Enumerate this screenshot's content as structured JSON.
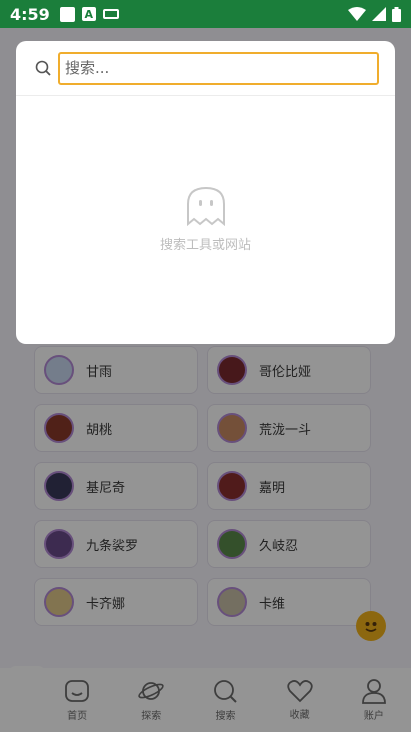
{
  "status_bar": {
    "time": "4:59"
  },
  "search": {
    "placeholder": "搜索...",
    "empty_text": "搜索工具或网站"
  },
  "cards": [
    {
      "label": "甘雨"
    },
    {
      "label": "哥伦比娅"
    },
    {
      "label": "胡桃"
    },
    {
      "label": "荒泷一斗"
    },
    {
      "label": "基尼奇"
    },
    {
      "label": "嘉明"
    },
    {
      "label": "九条裟罗"
    },
    {
      "label": "久岐忍"
    },
    {
      "label": "卡齐娜"
    },
    {
      "label": "卡维"
    }
  ],
  "nav": [
    {
      "label": "首页",
      "icon": "home-icon"
    },
    {
      "label": "探索",
      "icon": "planet-icon"
    },
    {
      "label": "搜索",
      "icon": "search-icon"
    },
    {
      "label": "收藏",
      "icon": "heart-icon"
    },
    {
      "label": "账户",
      "icon": "user-icon"
    }
  ],
  "colors": {
    "status_bar": "#1b7e3b",
    "focus_border": "#f0ad2d",
    "overlay": "rgba(0,0,0,0.42)"
  }
}
